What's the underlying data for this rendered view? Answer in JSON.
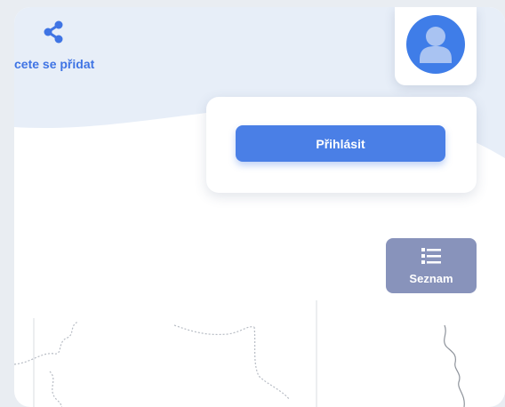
{
  "share": {
    "label": "cete se přidat",
    "icon": "share-icon"
  },
  "user": {
    "icon": "user-avatar-icon"
  },
  "login": {
    "button_label": "Přihlásit"
  },
  "list": {
    "label": "Seznam",
    "icon": "list-icon"
  },
  "colors": {
    "accent": "#4a7fe6",
    "list_button": "#8893bb",
    "header_bg": "#e7eef8"
  }
}
